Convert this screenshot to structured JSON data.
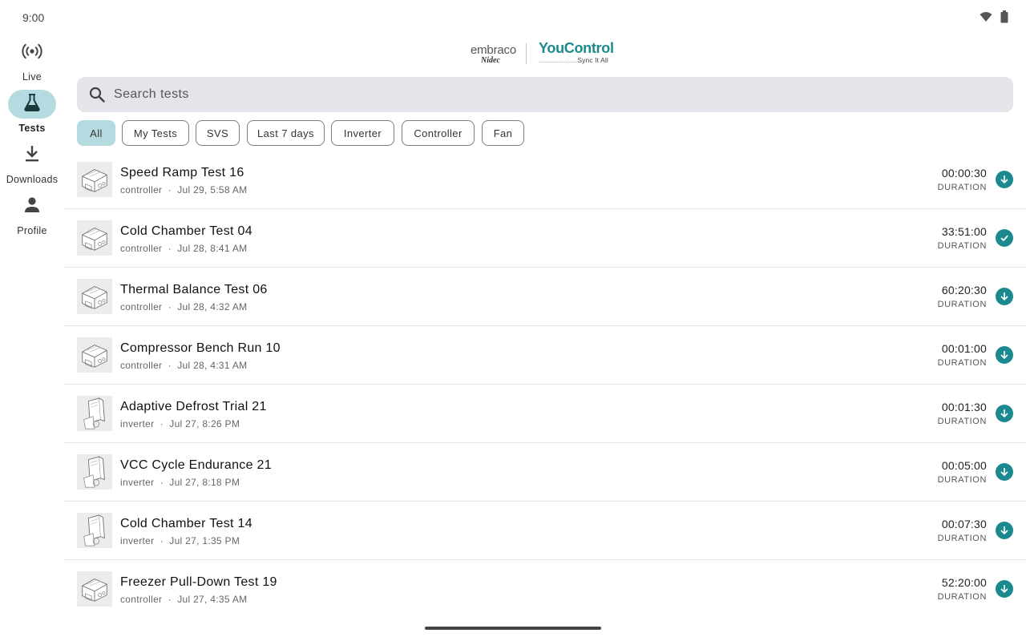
{
  "status_bar": {
    "time": "9:00",
    "icons": [
      "wifi-icon",
      "battery-icon"
    ]
  },
  "nav": {
    "items": [
      {
        "label": "Live",
        "icon": "broadcast-icon",
        "active": false
      },
      {
        "label": "Tests",
        "icon": "flask-icon",
        "active": true
      },
      {
        "label": "Downloads",
        "icon": "download-icon",
        "active": false
      },
      {
        "label": "Profile",
        "icon": "person-icon",
        "active": false
      }
    ]
  },
  "header": {
    "logo_brand": "embraco",
    "logo_parent": "Nidec",
    "logo_product": "YouControl",
    "logo_tagline": "Sync It All"
  },
  "search": {
    "placeholder": "Search tests",
    "value": ""
  },
  "filters": {
    "chips": [
      {
        "label": "All",
        "selected": true
      },
      {
        "label": "My Tests",
        "selected": false
      },
      {
        "label": "SVS",
        "selected": false
      },
      {
        "label": "Last 7 days",
        "selected": false
      },
      {
        "label": "Inverter",
        "selected": false
      },
      {
        "label": "Controller",
        "selected": false
      },
      {
        "label": "Fan",
        "selected": false
      }
    ]
  },
  "tests": {
    "duration_label": "DURATION",
    "items": [
      {
        "name": "Speed Ramp Test 16",
        "type": "controller",
        "date": "Jul 29, 5:58 AM",
        "duration": "00:00:30",
        "status": "download"
      },
      {
        "name": "Cold Chamber Test 04",
        "type": "controller",
        "date": "Jul 28, 8:41 AM",
        "duration": "33:51:00",
        "status": "downloaded"
      },
      {
        "name": "Thermal Balance Test 06",
        "type": "controller",
        "date": "Jul 28, 4:32 AM",
        "duration": "60:20:30",
        "status": "download"
      },
      {
        "name": "Compressor Bench Run 10",
        "type": "controller",
        "date": "Jul 28, 4:31 AM",
        "duration": "00:01:00",
        "status": "download"
      },
      {
        "name": "Adaptive Defrost Trial 21",
        "type": "inverter",
        "date": "Jul 27, 8:26 PM",
        "duration": "00:01:30",
        "status": "download"
      },
      {
        "name": "VCC Cycle Endurance 21",
        "type": "inverter",
        "date": "Jul 27, 8:18 PM",
        "duration": "00:05:00",
        "status": "download"
      },
      {
        "name": "Cold Chamber Test 14",
        "type": "inverter",
        "date": "Jul 27, 1:35 PM",
        "duration": "00:07:30",
        "status": "download"
      },
      {
        "name": "Freezer Pull-Down Test 19",
        "type": "controller",
        "date": "Jul 27, 4:35 AM",
        "duration": "52:20:00",
        "status": "download"
      }
    ]
  },
  "colors": {
    "accent": "#1b8a8f",
    "active_pill": "#b4dbe0",
    "search_bg": "#e4e5ea"
  }
}
